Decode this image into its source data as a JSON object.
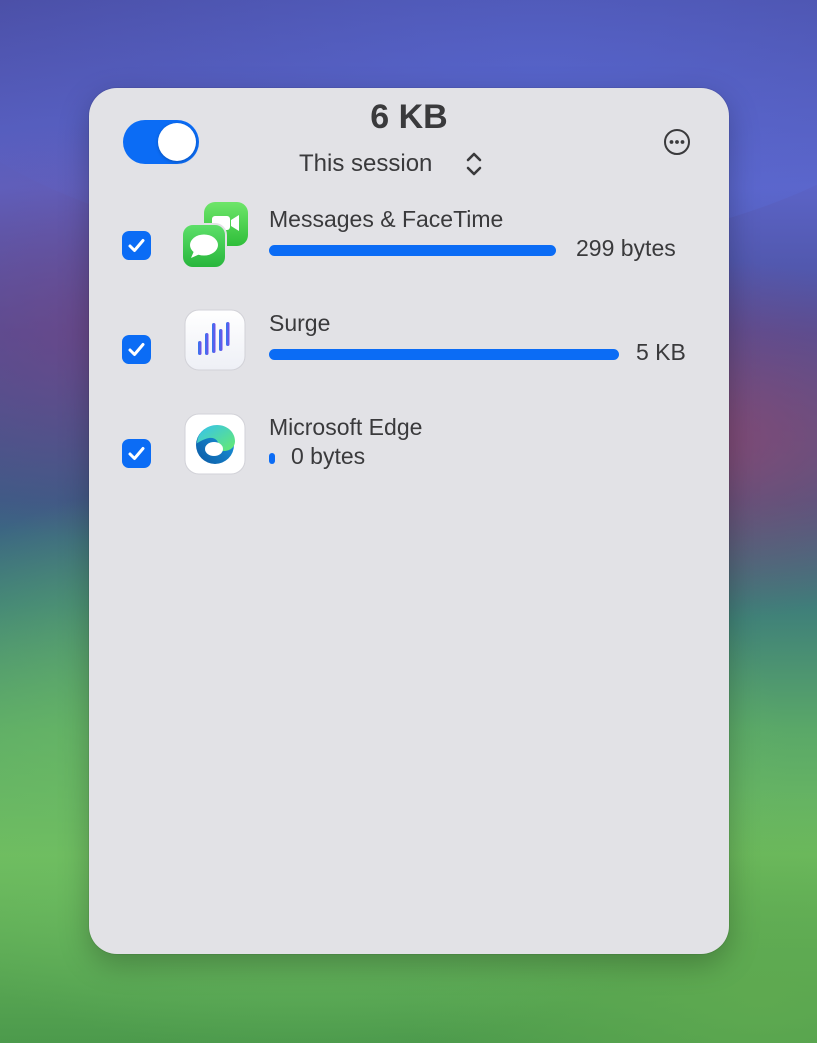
{
  "header": {
    "total": "6 KB",
    "period": "This session",
    "monitor_enabled": true
  },
  "apps": [
    {
      "name": "Messages & FaceTime",
      "amount": "299 bytes",
      "bar_fraction": 0.82,
      "checked": true,
      "icon": "messages-facetime-icon"
    },
    {
      "name": "Surge",
      "amount": "5 KB",
      "bar_fraction": 1.0,
      "checked": true,
      "icon": "surge-icon"
    },
    {
      "name": "Microsoft Edge",
      "amount": "0 bytes",
      "bar_fraction": 0.0,
      "checked": true,
      "icon": "microsoft-edge-icon"
    }
  ],
  "colors": {
    "accent": "#0b6cf5",
    "panel": "#e2e2e6",
    "text": "#3a3a3c"
  }
}
